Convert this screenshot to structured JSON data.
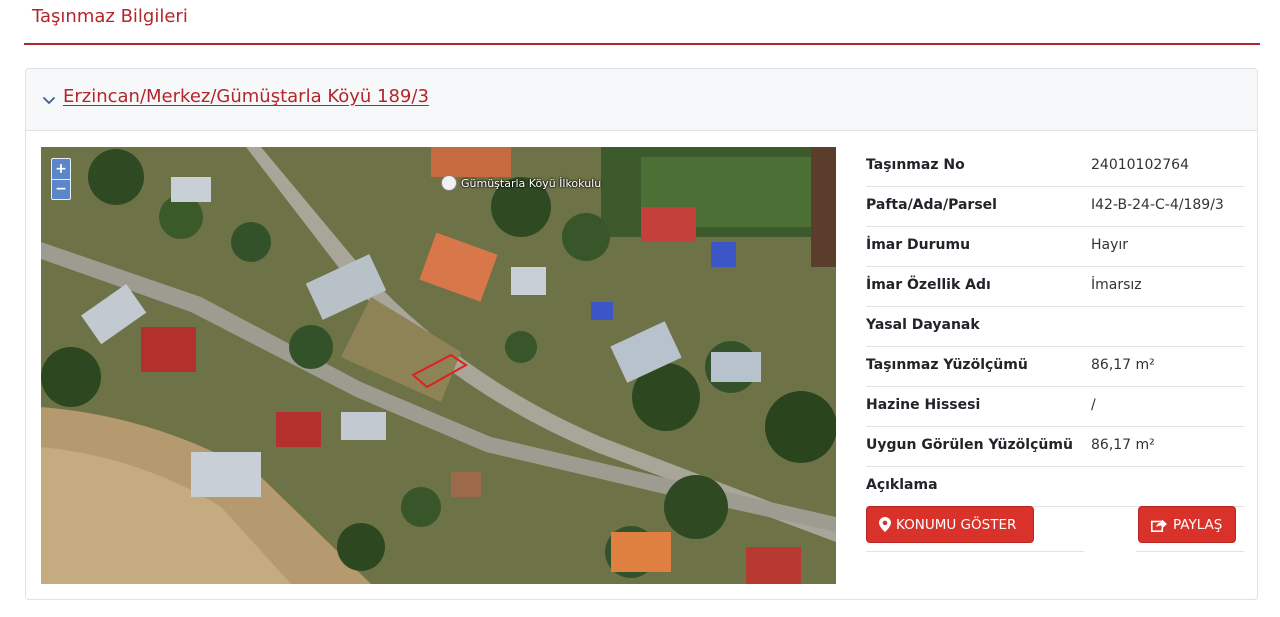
{
  "page": {
    "title": "Taşınmaz Bilgileri"
  },
  "parcel": {
    "link_text": "Erzincan/Merkez/Gümüştarla Köyü 189/3",
    "chevron_icon": "chevron-down-icon"
  },
  "map": {
    "zoom_in": "+",
    "zoom_out": "−",
    "poi_label": "Gümüştarla Köyü İlkokulu"
  },
  "info": {
    "rows": [
      {
        "label": "Taşınmaz No",
        "value": "24010102764"
      },
      {
        "label": "Pafta/Ada/Parsel",
        "value": "I42-B-24-C-4/189/3"
      },
      {
        "label": "İmar Durumu",
        "value": "Hayır"
      },
      {
        "label": "İmar Özellik Adı",
        "value": "İmarsız"
      },
      {
        "label": "Yasal Dayanak",
        "value": ""
      },
      {
        "label": "Taşınmaz Yüzölçümü",
        "value": "86,17 m²"
      },
      {
        "label": "Hazine Hissesi",
        "value": "/"
      },
      {
        "label": "Uygun Görülen Yüzölçümü",
        "value": "86,17 m²"
      },
      {
        "label": "Açıklama",
        "value": ""
      }
    ]
  },
  "actions": {
    "show_location": "KONUMU GÖSTER",
    "share": "PAYLAŞ"
  },
  "colors": {
    "accent": "#b3262b",
    "button": "#d9322b"
  }
}
